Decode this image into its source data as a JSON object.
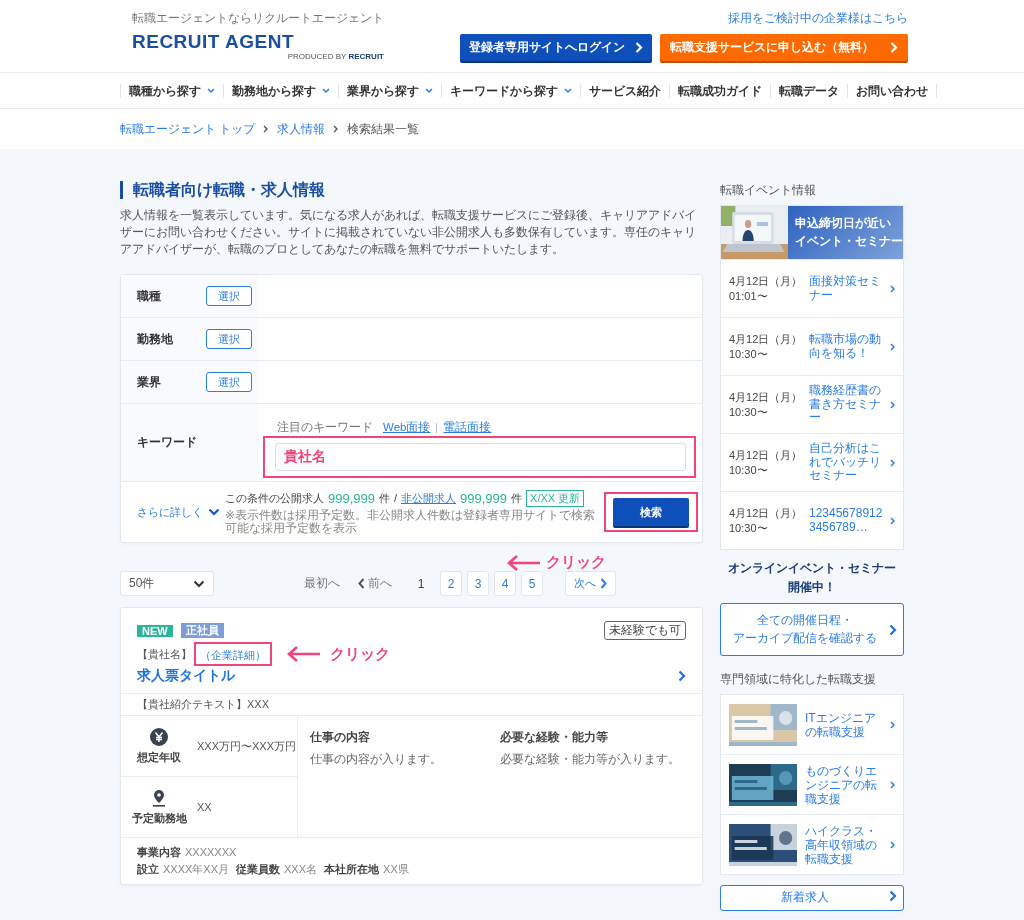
{
  "header": {
    "tagline": "転職エージェントならリクルートエージェント",
    "logo_text": "RECRUIT AGENT",
    "logo_sub": "PRODUCED BY",
    "logo_brand": "RECRUIT",
    "corporate_link": "採用をご検討中の企業様はこちら",
    "login_button": "登録者専用サイトへログイン",
    "apply_button": "転職支援サービスに申し込む（無料）"
  },
  "nav": [
    {
      "label": "職種から探す",
      "dropdown": true
    },
    {
      "label": "勤務地から探す",
      "dropdown": true
    },
    {
      "label": "業界から探す",
      "dropdown": true
    },
    {
      "label": "キーワードから探す",
      "dropdown": true
    },
    {
      "label": "サービス紹介",
      "dropdown": false
    },
    {
      "label": "転職成功ガイド",
      "dropdown": false
    },
    {
      "label": "転職データ",
      "dropdown": false
    },
    {
      "label": "お問い合わせ",
      "dropdown": false
    }
  ],
  "breadcrumb": [
    {
      "label": "転職エージェント トップ",
      "link": true
    },
    {
      "label": "求人情報",
      "link": true
    },
    {
      "label": "検索結果一覧",
      "link": false
    }
  ],
  "page_title": "転職者向け転職・求人情報",
  "intro": "求人情報を一覧表示しています。気になる求人があれば、転職支援サービスにご登録後、キャリアアドバイザーにお問い合わせください。サイトに掲載されていない非公開求人も多数保有しています。専任のキャリアアドバイザーが、転職のプロとしてあなたの転職を無料でサポートいたします。",
  "search_form": {
    "rows": [
      {
        "kind": "select",
        "label": "職種",
        "button": "選択"
      },
      {
        "kind": "select",
        "label": "勤務地",
        "button": "選択"
      },
      {
        "kind": "select",
        "label": "業界",
        "button": "選択"
      },
      {
        "kind": "keyword",
        "label": "キーワード",
        "hint_label": "注目のキーワード",
        "links": [
          "Web面接",
          "電話面接"
        ],
        "value": "貴社名"
      }
    ],
    "more_link": "さらに詳しく",
    "count_prefix": "この条件の公開求人",
    "public_count": "999,999",
    "unit": "件",
    "separator": "/",
    "private_link": "非公開求人",
    "private_count": "999,999",
    "private_unit": "件",
    "updated": "X/XX 更新",
    "note": "※表示件数は採用予定数。非公開求人件数は登録者専用サイトで検索可能な採用予定数を表示",
    "search_button": "検索",
    "annotation": "クリック"
  },
  "pagination": {
    "per_page": "50件",
    "first": "最初へ",
    "prev": "前へ",
    "pages": [
      {
        "label": "1",
        "selected": true
      },
      {
        "label": "2",
        "selected": false
      },
      {
        "label": "3",
        "selected": false
      },
      {
        "label": "4",
        "selected": false
      },
      {
        "label": "5",
        "selected": false
      }
    ],
    "next": "次へ"
  },
  "job_card": {
    "tags": [
      {
        "label": "NEW",
        "color": "#2bb59a"
      },
      {
        "label": "正社員",
        "color": "#7d9ed6"
      }
    ],
    "badge": "未経験でも可",
    "company": "【貴社名】",
    "detail_link": "（企業詳細）",
    "annotation": "クリック",
    "title": "求人票タイトル",
    "company_intro": "【貴社紹介テキスト】XXX",
    "salary": {
      "label": "想定年収",
      "value": "XXX万円〜XXX万円"
    },
    "location": {
      "label": "予定勤務地",
      "value": "XX"
    },
    "sections": [
      {
        "heading": "仕事の内容",
        "text": "仕事の内容が入ります。"
      },
      {
        "heading": "必要な経験・能力等",
        "text": "必要な経験・能力等が入ります。"
      }
    ],
    "business": {
      "label": "事業内容",
      "value": "XXXXXXX"
    },
    "details": [
      {
        "label": "設立",
        "value": "XXXX年XX月"
      },
      {
        "label": "従業員数",
        "value": "XXX名"
      },
      {
        "label": "本社所在地",
        "value": "XX県"
      }
    ]
  },
  "sidebar": {
    "events_heading": "転職イベント情報",
    "banner_title": [
      "申込締切日が近い",
      "イベント・セミナー"
    ],
    "events": [
      {
        "date": "4月12日（月）",
        "time": "01:01〜",
        "title": "面接対策セミナー"
      },
      {
        "date": "4月12日（月）",
        "time": "10:30〜",
        "title": "転職市場の動向を知る！"
      },
      {
        "date": "4月12日（月）",
        "time": "10:30〜",
        "title": "職務経歴書の書き方セミナー"
      },
      {
        "date": "4月12日（月）",
        "time": "10:30〜",
        "title": "自己分析はこれでバッチリセミナー"
      },
      {
        "date": "4月12日（月）",
        "time": "10:30〜",
        "title": "123456789123456789…"
      }
    ],
    "online_note": [
      "オンラインイベント・セミナー",
      "開催中！"
    ],
    "all_events_button": [
      "全ての開催日程・",
      "アーカイブ配信を確認する"
    ],
    "specialty_heading": "専門領域に特化した転職支援",
    "specialties": [
      {
        "title": "ITエンジニアの転職支援"
      },
      {
        "title": "ものづくりエンジニアの転職支援"
      },
      {
        "title": "ハイクラス・高年収領域の転職支援"
      }
    ],
    "new_jobs_button": "新着求人"
  }
}
